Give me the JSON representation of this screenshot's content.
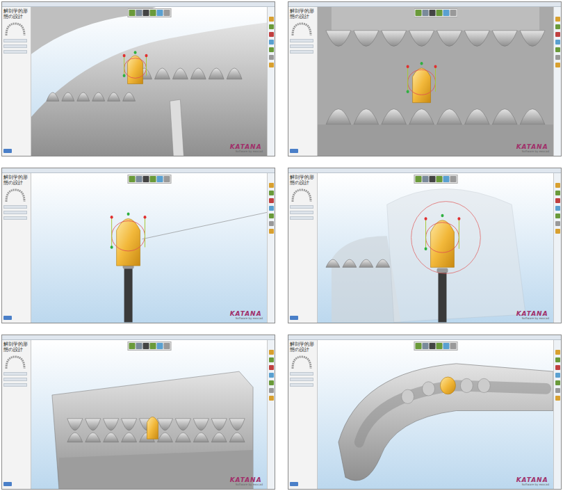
{
  "panels": [
    {
      "title": "解剖学的形態の設計",
      "logo": "KATANA",
      "logo_sub": "Software by exocad",
      "kind": "lower-jaw"
    },
    {
      "title": "解剖学的形態の設計",
      "logo": "KATANA",
      "logo_sub": "Software by exocad",
      "kind": "bite"
    },
    {
      "title": "解剖学的形態の設計",
      "logo": "KATANA",
      "logo_sub": "Software by exocad",
      "kind": "abutment"
    },
    {
      "title": "解剖学的形態の設計",
      "logo": "KATANA",
      "logo_sub": "Software by exocad",
      "kind": "abutment-ghost"
    },
    {
      "title": "解剖学的形態の設計",
      "logo": "KATANA",
      "logo_sub": "Software by exocad",
      "kind": "full-model"
    },
    {
      "title": "解剖学的形態の設計",
      "logo": "KATANA",
      "logo_sub": "Software by exocad",
      "kind": "arch"
    }
  ]
}
